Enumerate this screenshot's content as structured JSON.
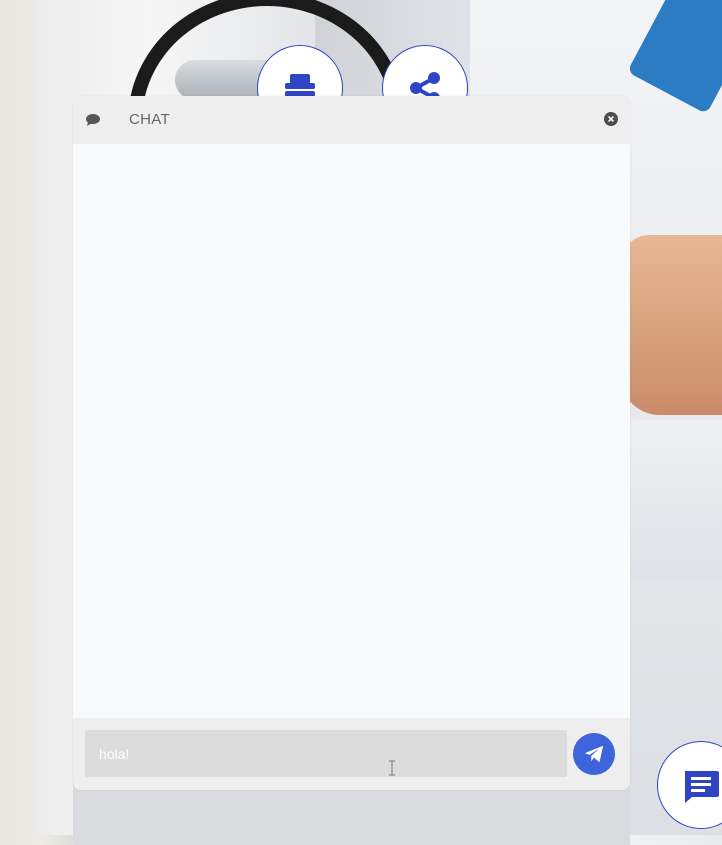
{
  "chat": {
    "title": "CHAT",
    "input_value": "hola!",
    "input_placeholder": ""
  },
  "icons": {
    "print": "print-icon",
    "share": "share-icon",
    "chat": "chat-bubble-icon",
    "close": "close-icon",
    "send": "send-icon",
    "fab": "message-icon"
  },
  "colors": {
    "accent": "#3d63dd",
    "button_border": "#2f45c6",
    "header_bg": "#eeeeee",
    "input_bg": "#dcdcdc"
  }
}
